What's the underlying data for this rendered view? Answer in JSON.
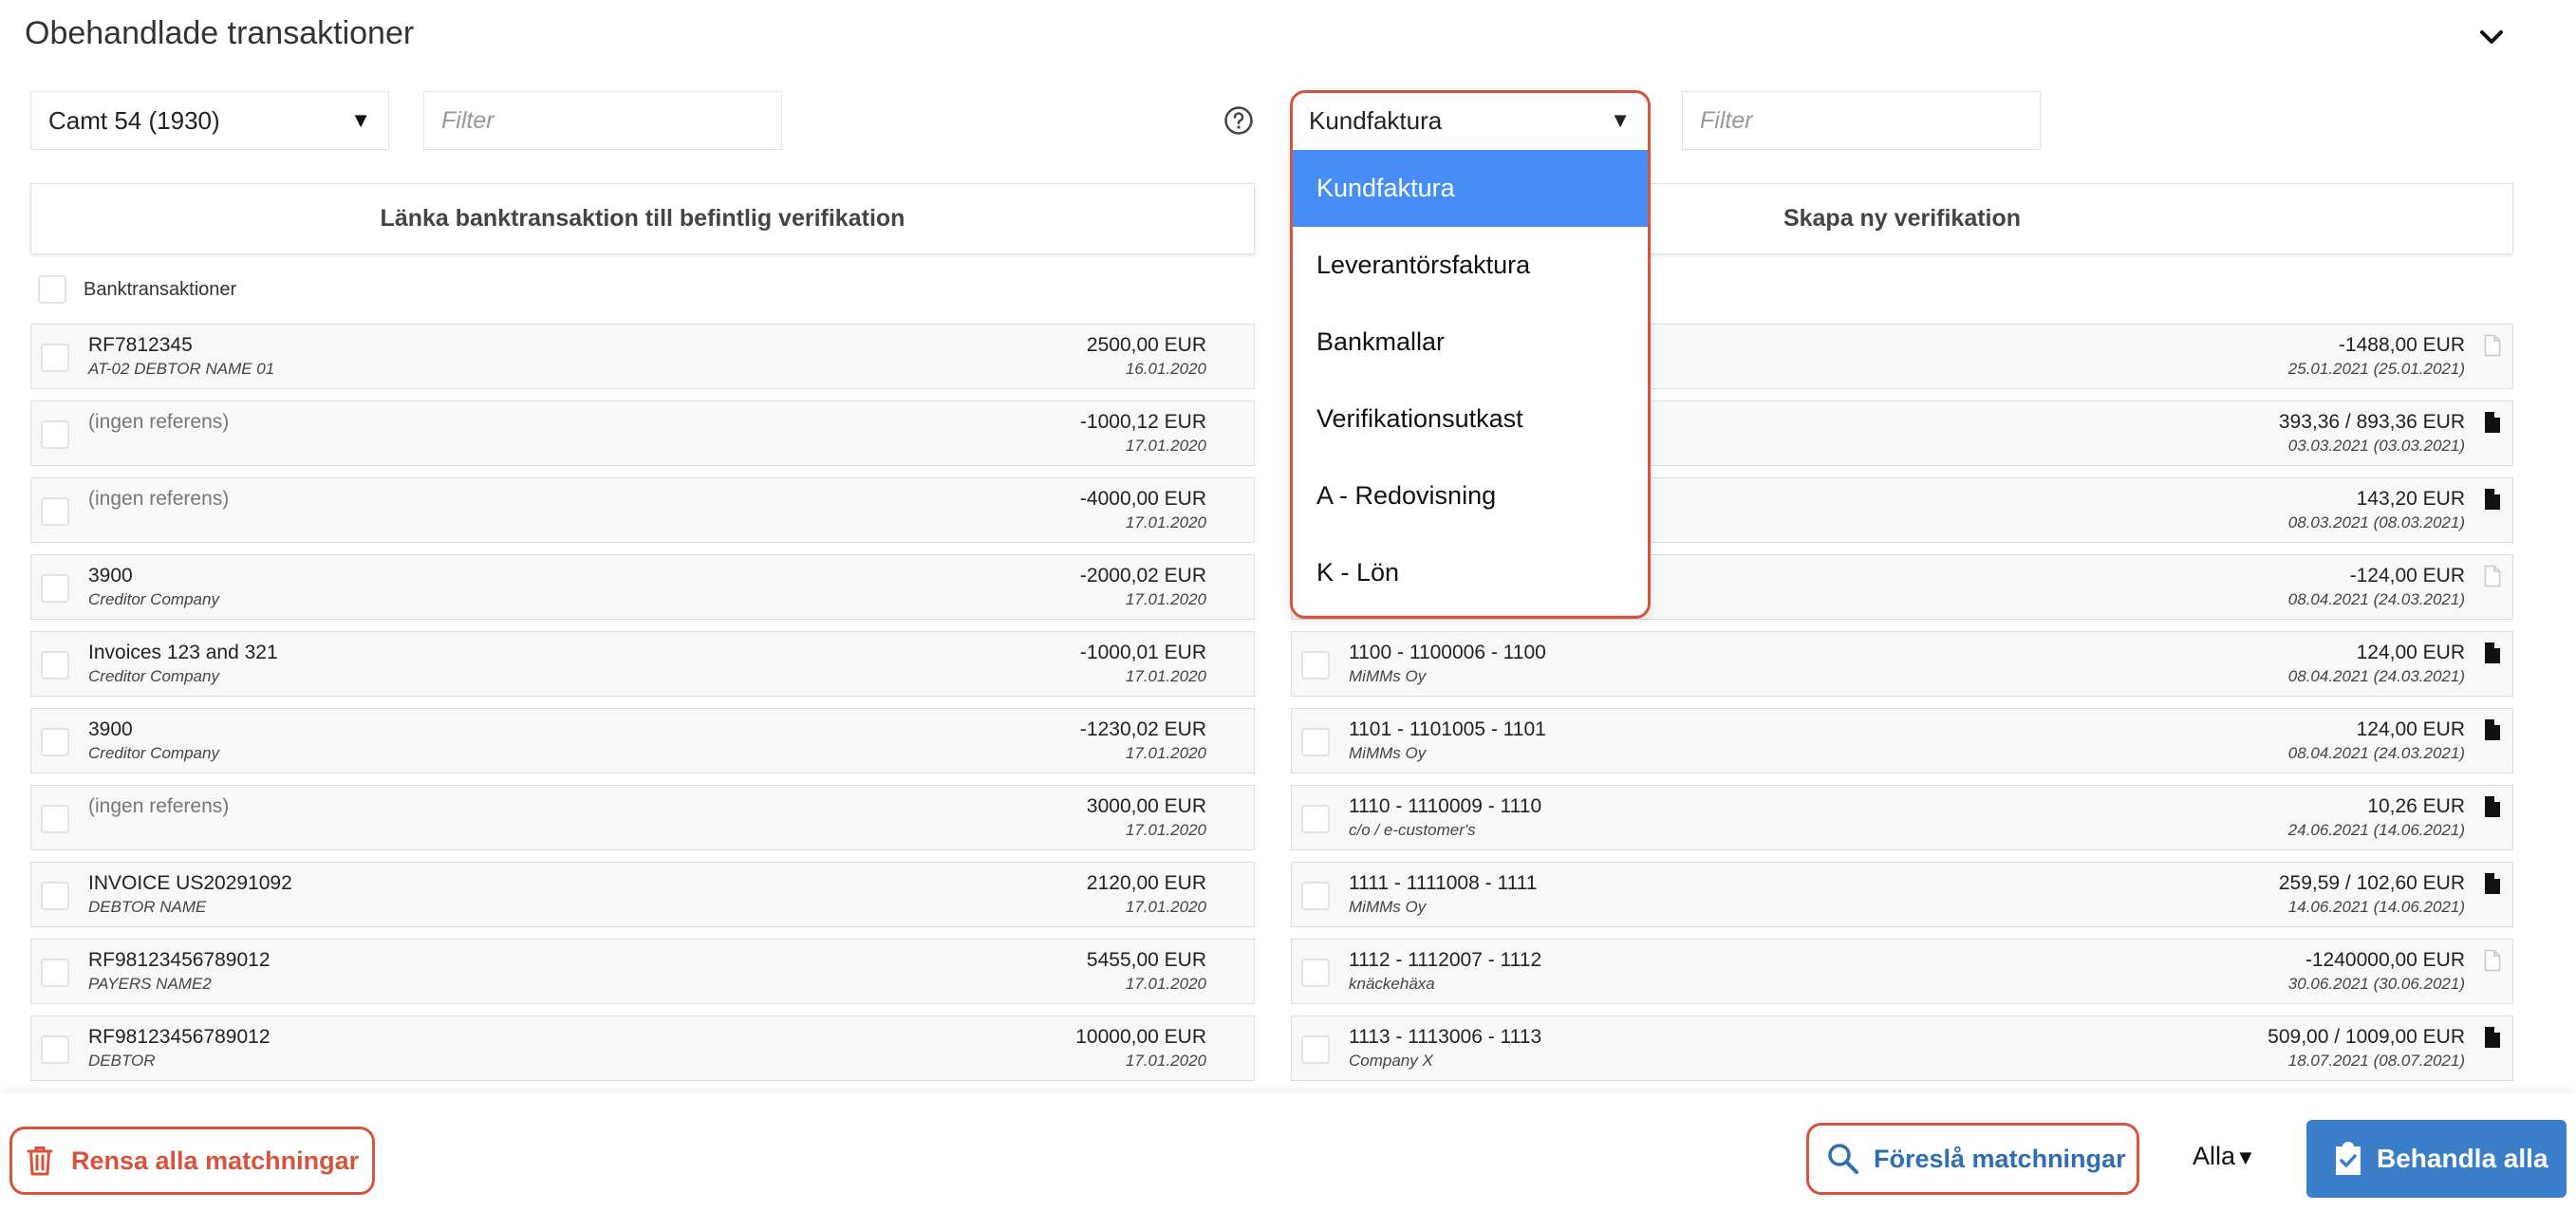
{
  "header": {
    "title": "Obehandlade transaktioner"
  },
  "left": {
    "account_select": "Camt 54 (1930)",
    "filter_placeholder": "Filter",
    "link_button": "Länka banktransaktion till befintlig verifikation",
    "select_all_label": "Banktransaktioner",
    "rows": [
      {
        "ref": "RF7812345",
        "sub": "AT-02 DEBTOR NAME 01",
        "amount": "2500,00 EUR",
        "date": "16.01.2020",
        "muted": false
      },
      {
        "ref": "(ingen referens)",
        "sub": "",
        "amount": "-1000,12 EUR",
        "date": "17.01.2020",
        "muted": true
      },
      {
        "ref": "(ingen referens)",
        "sub": "",
        "amount": "-4000,00 EUR",
        "date": "17.01.2020",
        "muted": true
      },
      {
        "ref": "3900",
        "sub": "Creditor Company",
        "amount": "-2000,02 EUR",
        "date": "17.01.2020",
        "muted": false
      },
      {
        "ref": "Invoices 123 and 321",
        "sub": "Creditor Company",
        "amount": "-1000,01 EUR",
        "date": "17.01.2020",
        "muted": false
      },
      {
        "ref": "3900",
        "sub": "Creditor Company",
        "amount": "-1230,02 EUR",
        "date": "17.01.2020",
        "muted": false
      },
      {
        "ref": "(ingen referens)",
        "sub": "",
        "amount": "3000,00 EUR",
        "date": "17.01.2020",
        "muted": true
      },
      {
        "ref": "INVOICE US20291092",
        "sub": "DEBTOR NAME",
        "amount": "2120,00 EUR",
        "date": "17.01.2020",
        "muted": false
      },
      {
        "ref": "RF98123456789012",
        "sub": "PAYERS NAME2",
        "amount": "5455,00 EUR",
        "date": "17.01.2020",
        "muted": false
      },
      {
        "ref": "RF98123456789012",
        "sub": "DEBTOR",
        "amount": "10000,00 EUR",
        "date": "17.01.2020",
        "muted": false
      }
    ]
  },
  "right": {
    "type_select": "Kundfaktura",
    "filter_placeholder": "Filter",
    "create_button": "Skapa ny verifikation",
    "dropdown_options": [
      "Kundfaktura",
      "Leverantörsfaktura",
      "Bankmallar",
      "Verifikationsutkast",
      "A - Redovisning",
      "K - Lön"
    ],
    "rows": [
      {
        "ref": "",
        "sub": "",
        "amount": "-1488,00 EUR",
        "date": "25.01.2021 (25.01.2021)",
        "doc": "doc-outline-icon"
      },
      {
        "ref": "",
        "sub": "",
        "amount": "393,36 / 893,36 EUR",
        "date": "03.03.2021 (03.03.2021)",
        "doc": "doc-filled-icon"
      },
      {
        "ref": "",
        "sub": "",
        "amount": "143,20 EUR",
        "date": "08.03.2021 (08.03.2021)",
        "doc": "doc-filled-icon"
      },
      {
        "ref": "",
        "sub": "",
        "amount": "-124,00 EUR",
        "date": "08.04.2021 (24.03.2021)",
        "doc": "doc-outline-icon"
      },
      {
        "ref": "1100 - 1100006 - 1100",
        "sub": "MiMMs Oy",
        "amount": "124,00 EUR",
        "date": "08.04.2021 (24.03.2021)",
        "doc": "doc-filled-icon"
      },
      {
        "ref": "1101 - 1101005 - 1101",
        "sub": "MiMMs Oy",
        "amount": "124,00 EUR",
        "date": "08.04.2021 (24.03.2021)",
        "doc": "doc-filled-icon"
      },
      {
        "ref": "1110 - 1110009 - 1110",
        "sub": "c/o / e-customer's",
        "amount": "10,26 EUR",
        "date": "24.06.2021 (14.06.2021)",
        "doc": "doc-filled-icon"
      },
      {
        "ref": "1111 - 1111008 - 1111",
        "sub": "MiMMs Oy",
        "amount": "259,59 / 102,60 EUR",
        "date": "14.06.2021 (14.06.2021)",
        "doc": "doc-filled-icon"
      },
      {
        "ref": "1112 - 1112007 - 1112",
        "sub": "knäckehäxa",
        "amount": "-1240000,00 EUR",
        "date": "30.06.2021 (30.06.2021)",
        "doc": "doc-outline-icon"
      },
      {
        "ref": "1113 - 1113006 - 1113",
        "sub": "Company X",
        "amount": "509,00 / 1009,00 EUR",
        "date": "18.07.2021 (08.07.2021)",
        "doc": "doc-filled-icon"
      }
    ]
  },
  "footer": {
    "clear_button": "Rensa alla matchningar",
    "suggest_button": "Föreslå matchningar",
    "scope_select": "Alla",
    "process_button": "Behandla alla"
  },
  "colors": {
    "accent": "#3a7dc8",
    "danger": "#d9533c",
    "dropdown_active": "#468ef5"
  }
}
